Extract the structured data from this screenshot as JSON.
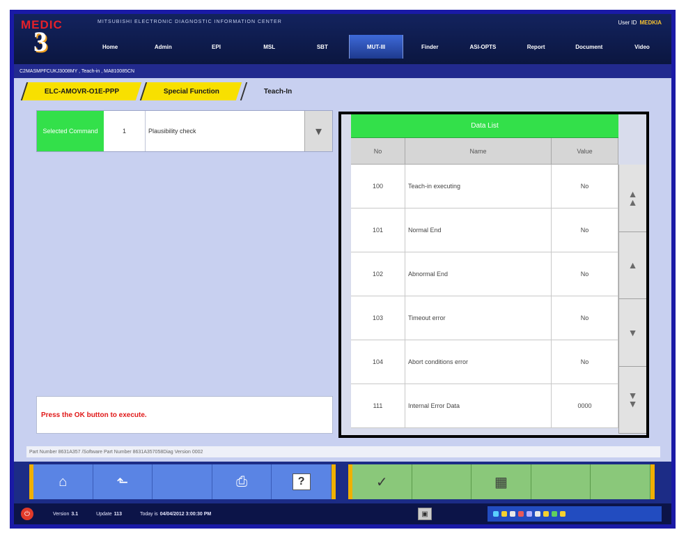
{
  "app": {
    "logo_text": "MEDIC",
    "logo_number": "3",
    "system_name": "MITSUBISHI ELECTRONIC DIAGNOSTIC INFORMATION CENTER",
    "user_id_label": "User ID",
    "user_id": "MEDKIA"
  },
  "nav": {
    "tabs": [
      "Home",
      "Admin",
      "EPI",
      "MSL",
      "SBT",
      "MUT-III",
      "Finder",
      "ASI-OPTS",
      "Report",
      "Document",
      "Video"
    ],
    "active_index": 5
  },
  "crumb_path": "C2MASMPFCUKJ3008MY  ,  Teach-in  ,  MA810085CN",
  "breadcrumb_tabs": [
    "ELC-AMOVR-O1E-PPP",
    "Special Function",
    "Teach-In"
  ],
  "command": {
    "label": "Selected Command",
    "number": "1",
    "text": "Plausibility check"
  },
  "message": "Press the OK button to execute.",
  "data_list": {
    "title": "Data List",
    "headers": {
      "no": "No",
      "name": "Name",
      "value": "Value"
    },
    "rows": [
      {
        "no": "100",
        "name": "Teach-in executing",
        "value": "No"
      },
      {
        "no": "101",
        "name": "Normal End",
        "value": "No"
      },
      {
        "no": "102",
        "name": "Abnormal End",
        "value": "No"
      },
      {
        "no": "103",
        "name": "Timeout error",
        "value": "No"
      },
      {
        "no": "104",
        "name": "Abort conditions error",
        "value": "No"
      },
      {
        "no": "111",
        "name": "Internal Error Data",
        "value": "0000"
      }
    ]
  },
  "part_info": "Part Number 8631A357  /Software Part Number 8631A357058Diag  Version 0002",
  "status": {
    "version_label": "Version",
    "version": "3.1",
    "update_label": "Update",
    "update": "113",
    "today_label": "Today is",
    "today": "04/04/2012 3:00:30 PM"
  }
}
